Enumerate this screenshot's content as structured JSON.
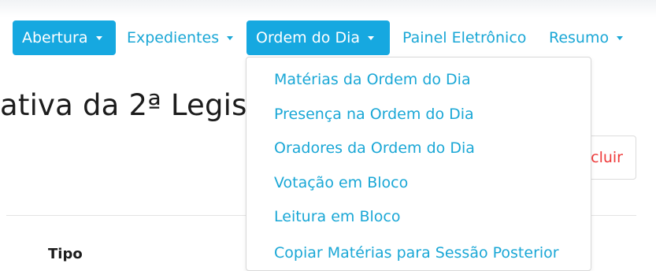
{
  "nav": {
    "items": [
      {
        "label": "Abertura",
        "has_caret": true
      },
      {
        "label": "Expedientes",
        "has_caret": true
      },
      {
        "label": "Ordem do Dia",
        "has_caret": true
      },
      {
        "label": "Painel Eletrônico",
        "has_caret": false
      },
      {
        "label": "Resumo",
        "has_caret": true
      }
    ],
    "active_index": [
      0,
      2
    ]
  },
  "dropdown": {
    "items": [
      "Matérias da Ordem do Dia",
      "Presença na Ordem do Dia",
      "Oradores da Ordem do Dia",
      "Votação em Bloco",
      "Leitura em Bloco",
      "Copiar Matérias para Sessão Posterior"
    ]
  },
  "page": {
    "title_partial": "ativa da 2ª Legisl",
    "excluir_partial": "cluir",
    "table_header_tipo": "Tipo"
  },
  "colors": {
    "accent": "#16a8e0",
    "link": "#1aa7d6",
    "danger": "#ef3b3b",
    "text": "#1c1c1c"
  },
  "icons": [
    "caret-down-icon"
  ]
}
